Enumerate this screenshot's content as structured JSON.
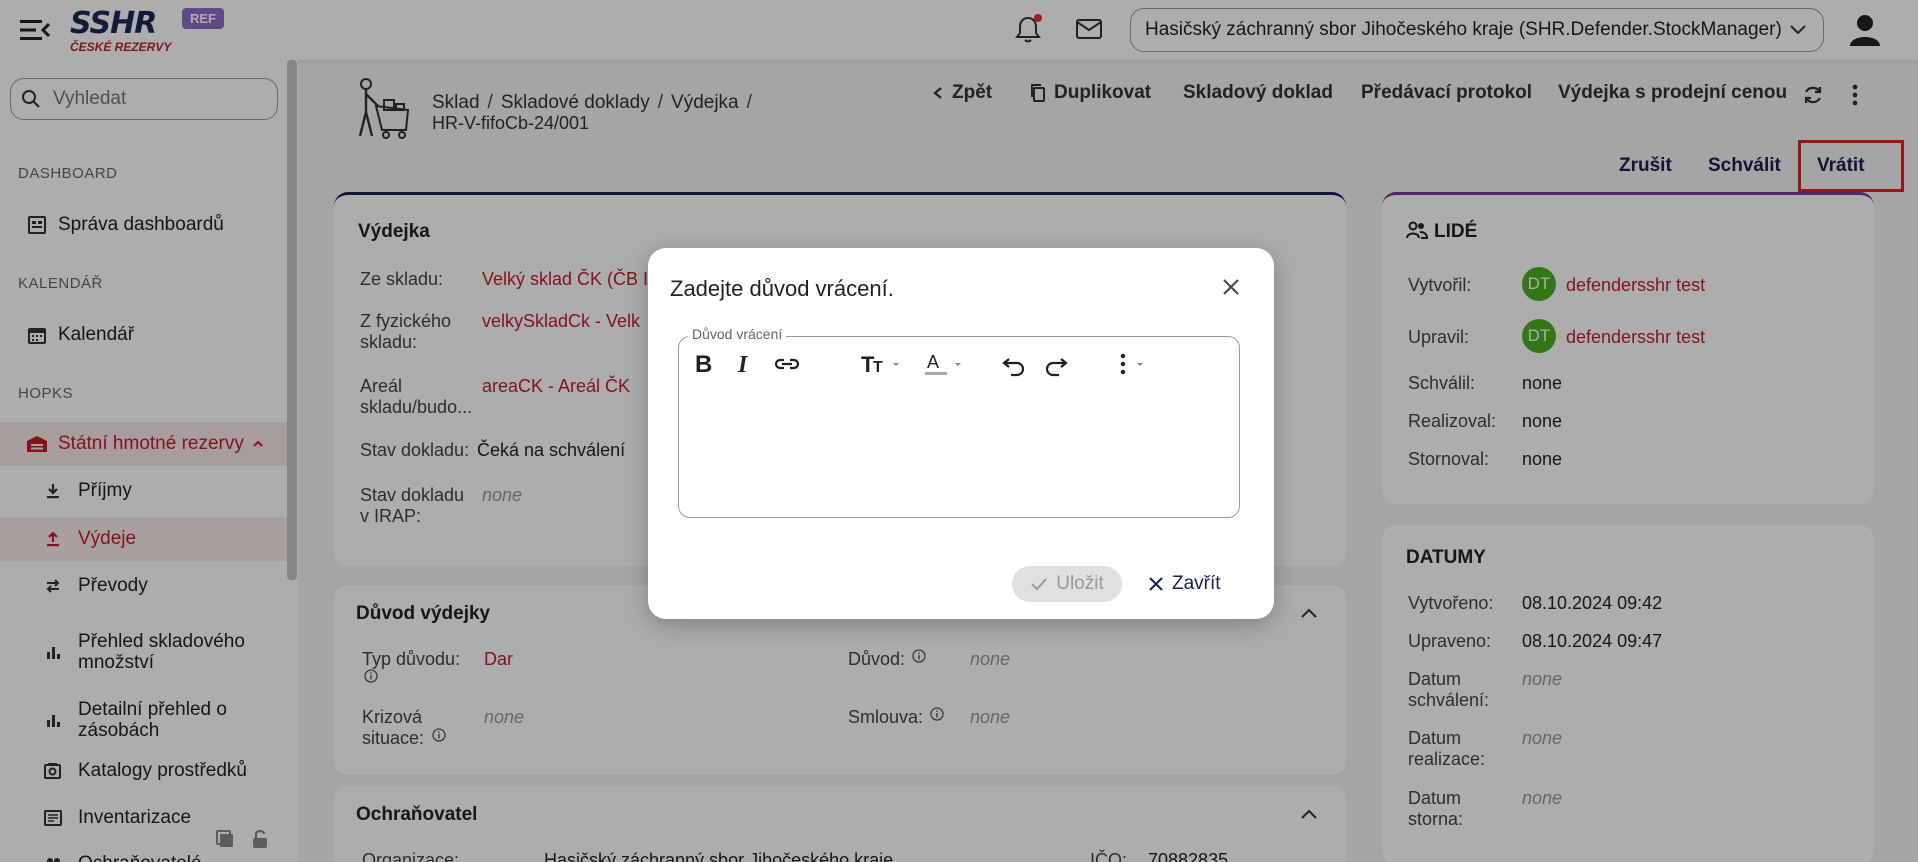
{
  "topbar": {
    "logo_text": "SSHR",
    "logo_sub": "ČESKÉ REZERVY",
    "env_badge": "REF",
    "org_select_value": "Hasičský záchranný sbor Jihočeského kraje (SHR.Defender.StockManager)"
  },
  "sidebar": {
    "search_placeholder": "Vyhledat",
    "sections": [
      {
        "title": "DASHBOARD"
      },
      {
        "title": "KALENDÁŘ"
      },
      {
        "title": "HOPKS"
      }
    ],
    "items": [
      {
        "label": "Správa dashboardů",
        "icon": "dashboard-icon"
      },
      {
        "label": "Kalendář",
        "icon": "calendar-icon"
      },
      {
        "label": "Státní hmotné rezervy",
        "icon": "warehouse-icon"
      },
      {
        "label": "Příjmy",
        "icon": "download-icon"
      },
      {
        "label": "Výdeje",
        "icon": "upload-icon"
      },
      {
        "label": "Převody",
        "icon": "transfer-icon"
      },
      {
        "label": "Přehled skladového",
        "label2": "množství",
        "icon": "bar-chart-icon"
      },
      {
        "label": "Detailní přehled o",
        "label2": "zásobách",
        "icon": "bar-chart-icon"
      },
      {
        "label": "Katalogy prostředků",
        "icon": "catalog-icon"
      },
      {
        "label": "Inventarizace",
        "icon": "inventory-icon"
      },
      {
        "label": "Ochraňovatelé",
        "icon": "protectors-icon"
      }
    ]
  },
  "header": {
    "breadcrumb": [
      "Sklad",
      "Skladové doklady",
      "Výdejka"
    ],
    "doc_number": "HR-V-fifoCb-24/001",
    "toolbar": {
      "back": "Zpět",
      "duplicate": "Duplikovat",
      "stock_doc": "Skladový doklad",
      "handover": "Předávací protokol",
      "sale_price": "Výdejka s prodejní cenou"
    },
    "actions": {
      "cancel": "Zrušit",
      "approve": "Schválit",
      "return": "Vrátit"
    }
  },
  "vydejka": {
    "title": "Výdejka",
    "from_warehouse_label": "Ze skladu:",
    "from_warehouse": "Velký sklad ČK (ČB I",
    "physical_label_1": "Z fyzického",
    "physical_label_2": "skladu:",
    "physical": "velkySkladCk - Velk",
    "area_label_1": "Areál",
    "area_label_2": "skladu/budo...",
    "area": "areaCK - Areál ČK",
    "state_label": "Stav dokladu:",
    "state": "Čeká na schválení",
    "irap_label_1": "Stav dokladu",
    "irap_label_2": "v IRAP:",
    "irap": "none"
  },
  "reason": {
    "title": "Důvod výdejky",
    "type_label": "Typ důvodu:",
    "type": "Dar",
    "reason_label": "Důvod:",
    "reason": "none",
    "crisis_label_1": "Krizová",
    "crisis_label_2": "situace:",
    "crisis": "none",
    "contract_label": "Smlouva:",
    "contract": "none"
  },
  "protector": {
    "title": "Ochraňovatel",
    "org_label": "Organizace:",
    "org": "Hasičský záchranný sbor Jihočeského kraje",
    "ico_label": "IČO:",
    "ico": "70882835"
  },
  "people": {
    "title": "LIDÉ",
    "created_label": "Vytvořil:",
    "created_initials": "DT",
    "created": "defendersshr test",
    "updated_label": "Upravil:",
    "updated_initials": "DT",
    "updated": "defendersshr test",
    "approved_label": "Schválil:",
    "approved": "none",
    "realized_label": "Realizoval:",
    "realized": "none",
    "cancelled_label": "Stornoval:",
    "cancelled": "none"
  },
  "dates": {
    "title": "DATUMY",
    "created_label": "Vytvořeno:",
    "created": "08.10.2024 09:42",
    "updated_label": "Upraveno:",
    "updated": "08.10.2024 09:47",
    "approved_label_1": "Datum",
    "approved_label_2": "schválení:",
    "approved": "none",
    "realized_label_1": "Datum",
    "realized_label_2": "realizace:",
    "realized": "none",
    "storno_label_1": "Datum",
    "storno_label_2": "storna:",
    "storno": "none"
  },
  "modal": {
    "title": "Zadejte důvod vrácení.",
    "field_label": "Důvod vrácení",
    "save": "Uložit",
    "close": "Zavřít"
  },
  "colors": {
    "brand_red": "#c0202a",
    "navy": "#1a2050",
    "avatar_green": "#4caf20",
    "highlight": "#e02020"
  }
}
